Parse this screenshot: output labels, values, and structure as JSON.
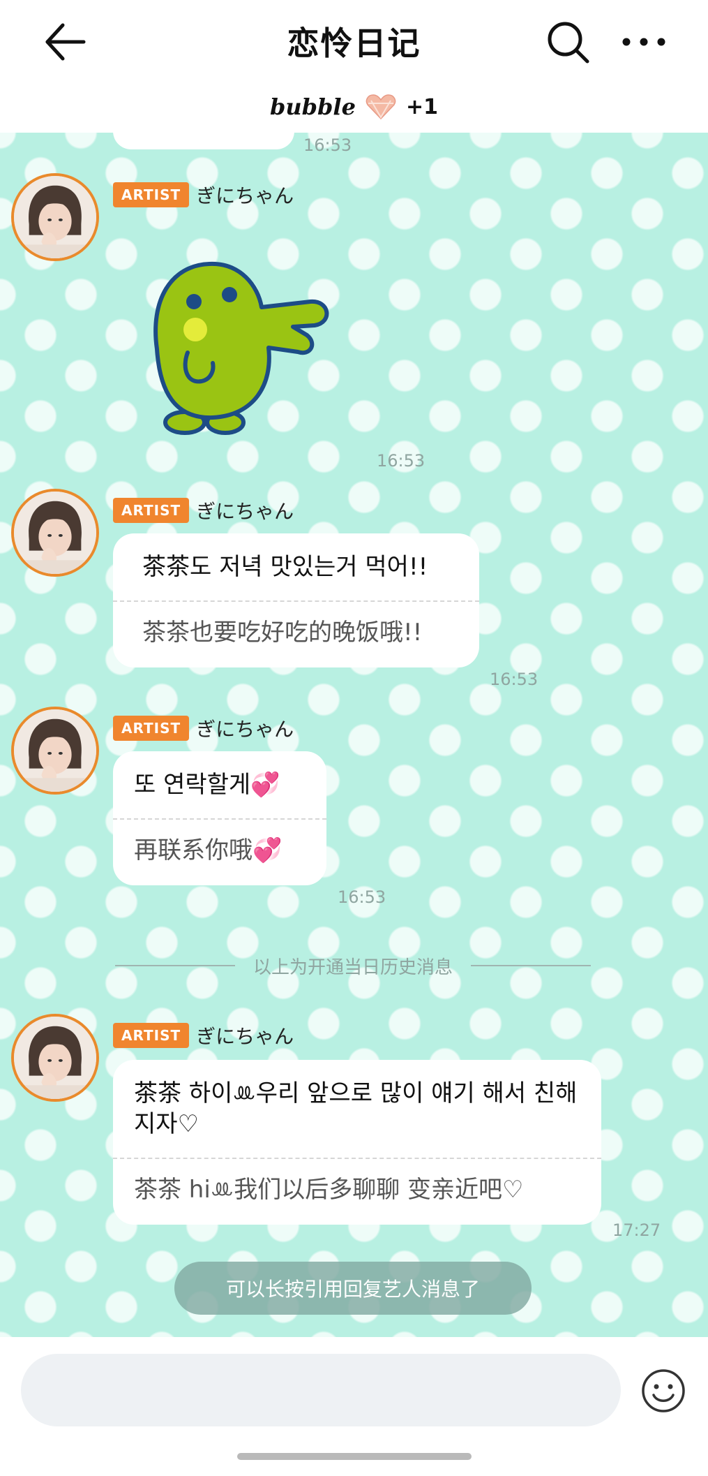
{
  "header": {
    "title": "恋怜日记",
    "brand": "bubble",
    "extra_count": "+1"
  },
  "colors": {
    "chat_background": "#b8f0e2",
    "artist_badge": "#f0852e",
    "avatar_ring": "#e98a2c"
  },
  "chat": {
    "previous_time": "16:53",
    "messages": [
      {
        "badge": "ARTIST",
        "name": "ぎにちゃん",
        "type": "sticker",
        "sticker": "green-bird-sticker",
        "time": "16:53"
      },
      {
        "badge": "ARTIST",
        "name": "ぎにちゃん",
        "type": "text",
        "ko": "茶茶도 저녁 맛있는거 먹어!!",
        "zh": "茶茶也要吃好吃的晚饭哦!!",
        "time": "16:53"
      },
      {
        "badge": "ARTIST",
        "name": "ぎにちゃん",
        "type": "text",
        "ko": "또 연락할게💞",
        "zh": "再联系你哦💞",
        "time": "16:53"
      },
      {
        "badge": "ARTIST",
        "name": "ぎにちゃん",
        "type": "text",
        "ko": "茶茶 하이ꔛ우리 앞으로 많이 얘기 해서 친해지자♡",
        "zh": "茶茶 hiꔛ我们以后多聊聊 变亲近吧♡",
        "time": "17:27"
      }
    ],
    "history_divider": "以上为开通当日历史消息",
    "toast": "可以长按引用回复艺人消息了"
  },
  "input": {
    "placeholder": ""
  }
}
